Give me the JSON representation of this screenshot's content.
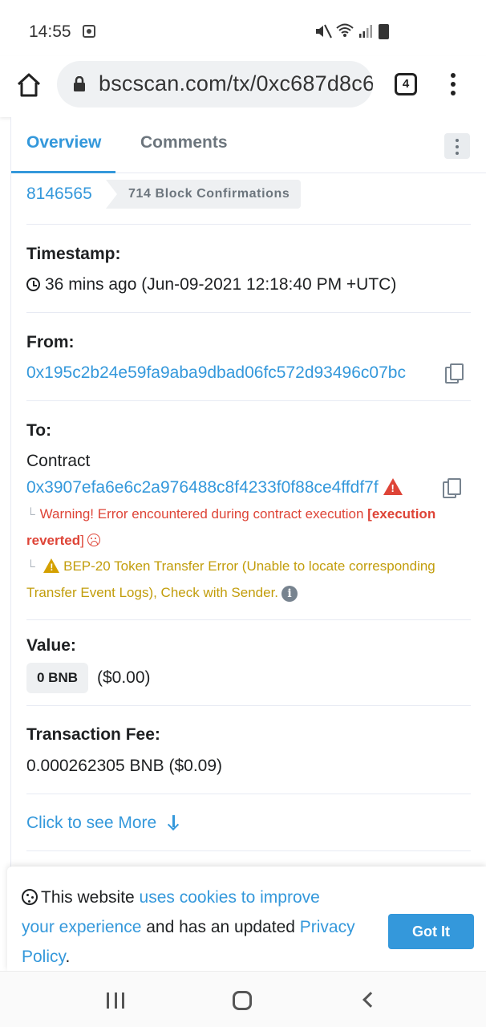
{
  "status": {
    "time": "14:55",
    "icons": [
      "notification-icon",
      "mute-icon",
      "wifi-icon",
      "signal-icon",
      "battery-icon"
    ]
  },
  "browser": {
    "url": "bscscan.com/tx/0xc687d8c6",
    "tab_count": "4"
  },
  "tabs": {
    "overview": "Overview",
    "comments": "Comments"
  },
  "block": {
    "number": "8146565",
    "confirmations": "714 Block Confirmations"
  },
  "timestamp": {
    "label": "Timestamp:",
    "value": "36 mins ago (Jun-09-2021 12:18:40 PM +UTC)"
  },
  "from": {
    "label": "From:",
    "address": "0x195c2b24e59fa9aba9dbad06fc572d93496c07bc"
  },
  "to": {
    "label": "To:",
    "type": "Contract",
    "address": "0x3907efa6e6c2a976488c8f4233f0f88ce4ffdf7f",
    "error_prefix": "Warning! Error encountered during contract execution ",
    "error_bracket_open": "[",
    "error_strong_1": "execution",
    "error_strong_2": "reverted",
    "error_bracket_close": "]",
    "warning_line1": "BEP-20 Token Transfer Error (Unable to locate corresponding",
    "warning_line2": "Transfer Event Logs), Check with Sender."
  },
  "value": {
    "label": "Value:",
    "amount": "0 BNB",
    "usd": "($0.00)"
  },
  "fee": {
    "label": "Transaction Fee:",
    "value": "0.000262305 BNB ($0.09)"
  },
  "more": {
    "label": "Click to see More"
  },
  "cookie": {
    "text1": "This website ",
    "link1a": "uses cookies to improve",
    "link1b": "your experience",
    "text2": " and has an updated ",
    "link2a": "Privacy",
    "link2b": "Policy",
    "text3": ".",
    "button": "Got It"
  },
  "colors": {
    "link": "#3498db",
    "error": "#de4437",
    "warning": "#c29d0b",
    "accent_button": "#3498db"
  }
}
